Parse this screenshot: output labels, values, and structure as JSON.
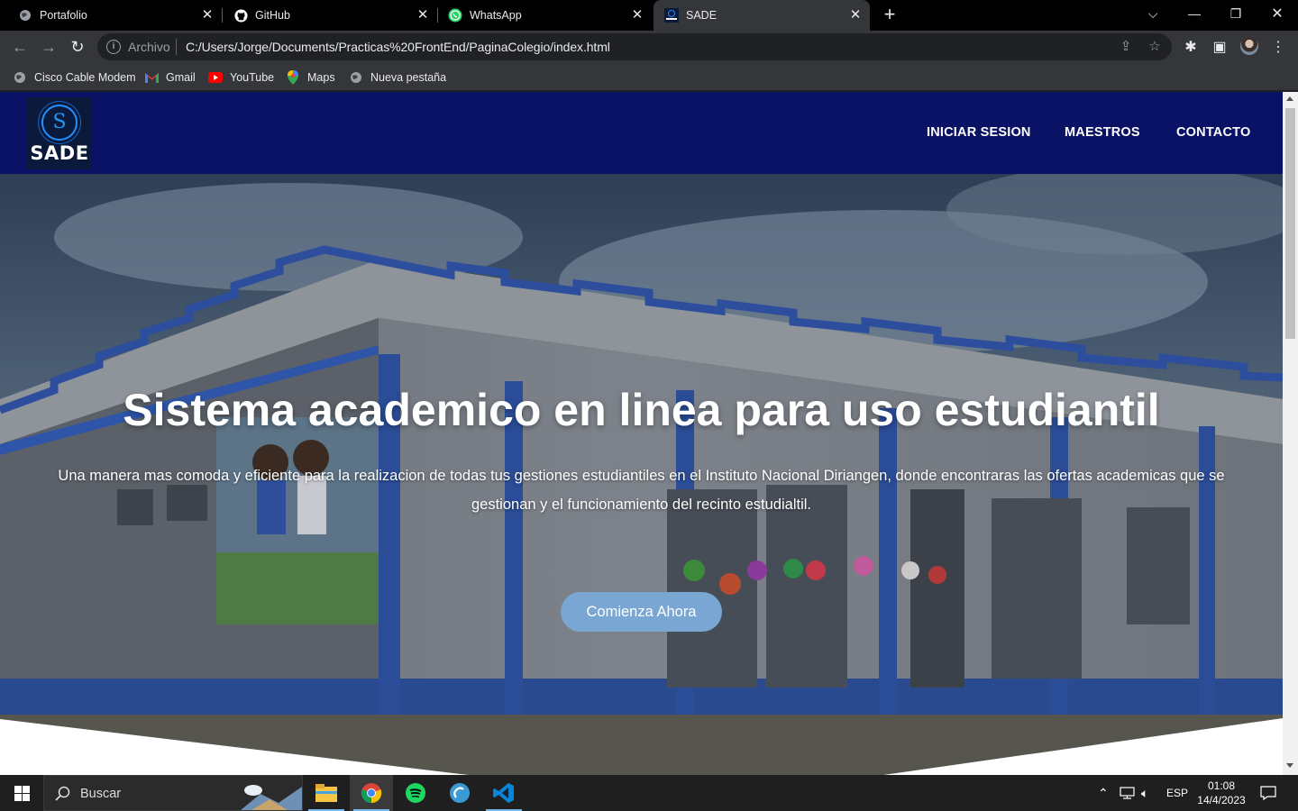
{
  "browser": {
    "tabs": [
      {
        "title": "Portafolio",
        "icon": "chrome-globe-icon"
      },
      {
        "title": "GitHub",
        "icon": "github-icon"
      },
      {
        "title": "WhatsApp",
        "icon": "whatsapp-icon"
      },
      {
        "title": "SADE",
        "icon": "sade-favicon",
        "active": true
      }
    ],
    "new_tab": "+",
    "address": {
      "scheme_label": "Archivo",
      "url": "C:/Users/Jorge/Documents/Practicas%20FrontEnd/PaginaColegio/index.html"
    },
    "bookmarks": [
      {
        "label": "Cisco Cable Modem",
        "icon": "globe-icon"
      },
      {
        "label": "Gmail",
        "icon": "gmail-icon"
      },
      {
        "label": "YouTube",
        "icon": "youtube-icon"
      },
      {
        "label": "Maps",
        "icon": "maps-pin-icon"
      },
      {
        "label": "Nueva pestaña",
        "icon": "globe-icon"
      }
    ]
  },
  "site": {
    "logo": {
      "text": "SADE",
      "mark": "S"
    },
    "nav": [
      {
        "label": "INICIAR SESION"
      },
      {
        "label": "MAESTROS"
      },
      {
        "label": "CONTACTO"
      }
    ],
    "hero": {
      "title": "Sistema academico en linea para uso estudiantil",
      "text": "Una manera mas comoda y eficiente para la realizacion de todas tus gestiones estudiantiles en el Instituto Nacional Diriangen, donde encontraras las ofertas academicas que se gestionan y el funcionamiento del recinto estudialtil.",
      "cta": "Comienza Ahora"
    },
    "colors": {
      "header": "#0a1266",
      "cta": "#79a6d2"
    }
  },
  "taskbar": {
    "search_placeholder": "Buscar",
    "apps": [
      "file-explorer-icon",
      "chrome-icon",
      "spotify-icon",
      "simplenote-icon",
      "vscode-icon"
    ],
    "language": "ESP",
    "time": "01:08",
    "date": "14/4/2023"
  }
}
